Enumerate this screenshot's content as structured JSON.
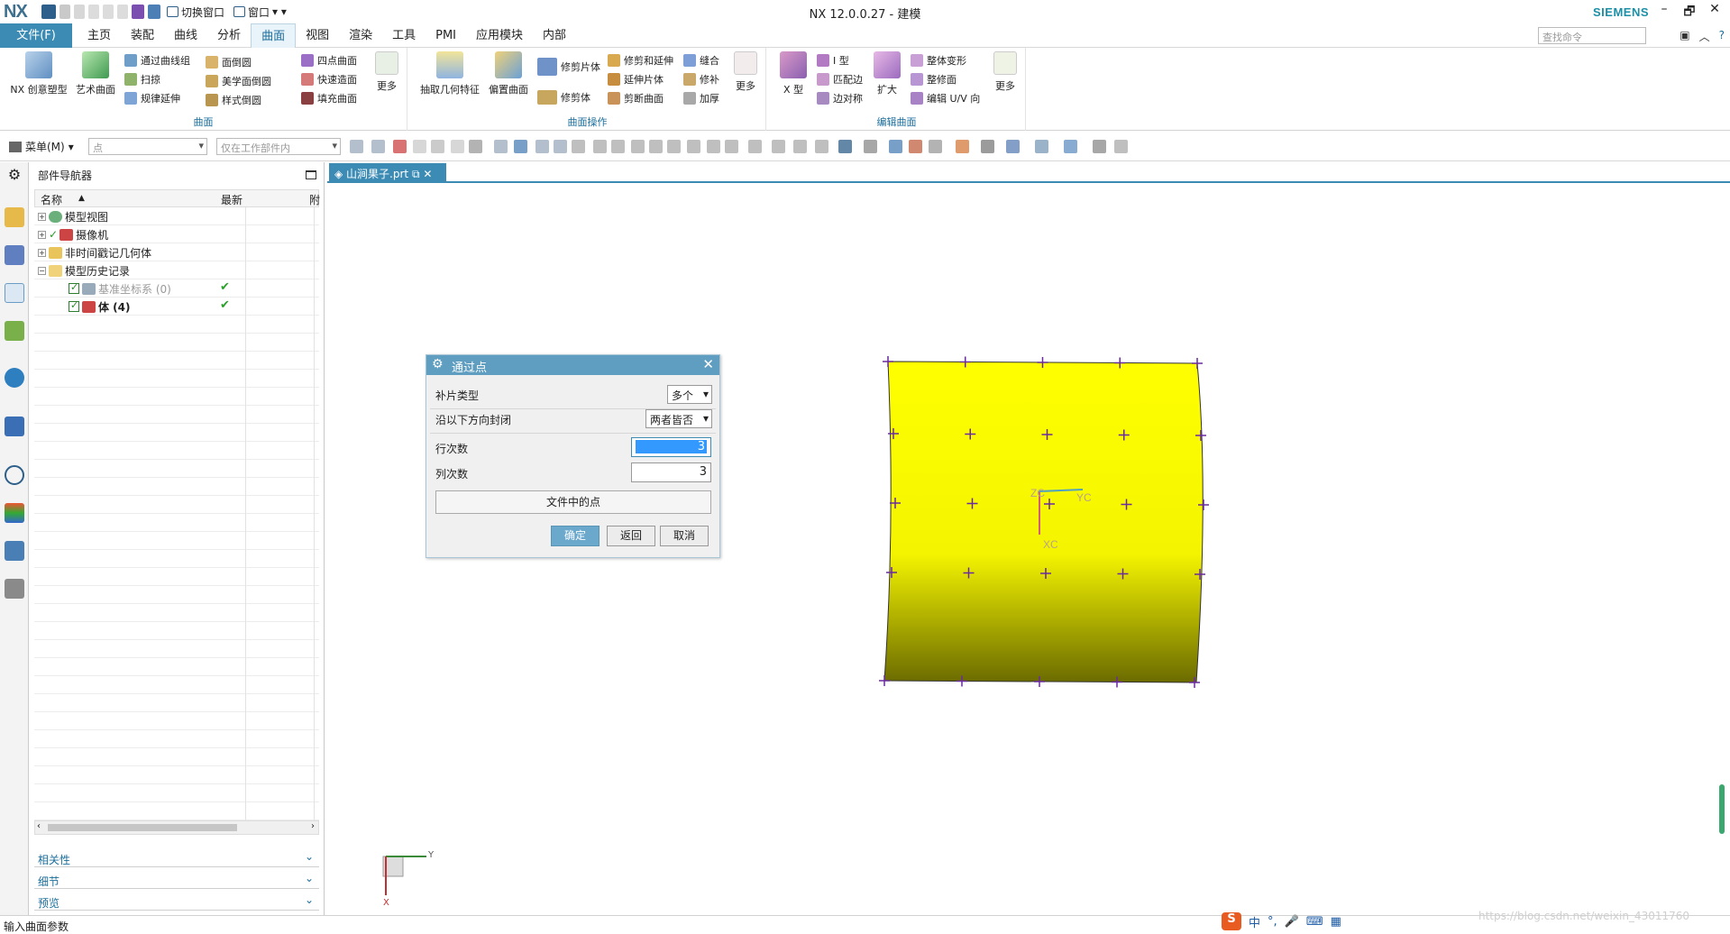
{
  "titlebar": {
    "logo": "NX",
    "switch_window": "切换窗口",
    "window": "窗口",
    "title": "NX 12.0.0.27 - 建模",
    "brand": "SIEMENS",
    "minimize": "–",
    "restore": "🗗",
    "close": "✕"
  },
  "menubar": {
    "file": "文件(F)",
    "tabs": [
      "主页",
      "装配",
      "曲线",
      "分析",
      "曲面",
      "视图",
      "渲染",
      "工具",
      "PMI",
      "应用模块",
      "内部"
    ],
    "active_tab": "曲面",
    "search_placeholder": "查找命令"
  },
  "ribbon": {
    "groups": {
      "surface": "曲面",
      "surface_ops": "曲面操作",
      "edit_surface": "编辑曲面"
    },
    "surface": {
      "nx_creative": "NX 创意塑型",
      "art_surface": "艺术曲面",
      "through_curve_mesh": "通过曲线组",
      "sweep": "扫掠",
      "law_extension": "规律延伸",
      "face_blend": "面倒圆",
      "aesthetic_blend": "美学面倒圆",
      "styled_blend": "样式倒圆",
      "four_point": "四点曲面",
      "quick_surface": "快速造面",
      "fill_surface": "填充曲面",
      "more": "更多"
    },
    "ops": {
      "extract_geometry": "抽取几何特征",
      "offset_surface": "偏置曲面",
      "trim_sheet": "修剪片体",
      "trim_body": "修剪体",
      "trim_extend": "修剪和延伸",
      "extend_sheet": "延伸片体",
      "cut_surface": "剪断曲面",
      "sew": "缝合",
      "patch": "修补",
      "thicken": "加厚",
      "more": "更多"
    },
    "edit": {
      "x_form": "X 型",
      "i_form": "I 型",
      "match_edge": "匹配边",
      "edge_symmetry": "边对称",
      "enlarge": "扩大",
      "global_deform": "整体变形",
      "shape_face": "整修面",
      "edit_uv": "编辑 U/V 向",
      "more": "更多"
    }
  },
  "toolbar2": {
    "menu": "菜单(M)",
    "filter_type": "点",
    "filter_scope": "仅在工作部件内"
  },
  "navigator": {
    "title": "部件导航器",
    "col_name": "名称",
    "col_latest": "最新",
    "col_extra": "附",
    "rows": [
      {
        "label": "模型视图",
        "check": ""
      },
      {
        "label": "摄像机",
        "check": ""
      },
      {
        "label": "非时间戳记几何体",
        "check": ""
      },
      {
        "label": "模型历史记录",
        "check": ""
      },
      {
        "label": "基准坐标系 (0)",
        "check": "✔"
      },
      {
        "label": "体 (4)",
        "check": "✔"
      }
    ],
    "panels": [
      "相关性",
      "细节",
      "预览"
    ]
  },
  "document_tab": "山涧果子.prt",
  "dialog": {
    "title": "通过点",
    "patch_type_label": "补片类型",
    "patch_type": "多个",
    "closed_label": "沿以下方向封闭",
    "closed_value": "两者皆否",
    "row_degree_label": "行次数",
    "row_degree": "3",
    "col_degree_label": "列次数",
    "col_degree": "3",
    "points_from_file": "文件中的点",
    "ok": "确定",
    "back": "返回",
    "cancel": "取消"
  },
  "viewport": {
    "axis_zc": "ZC",
    "axis_yc": "YC",
    "axis_xc": "XC",
    "tri_y": "Y",
    "tri_x": "X",
    "surface_color": "#ffff00"
  },
  "statusbar": {
    "prompt": "输入曲面参数"
  },
  "ime": {
    "logo": "S",
    "lang": "中"
  },
  "watermark": "https://blog.csdn.net/weixin_43011760"
}
